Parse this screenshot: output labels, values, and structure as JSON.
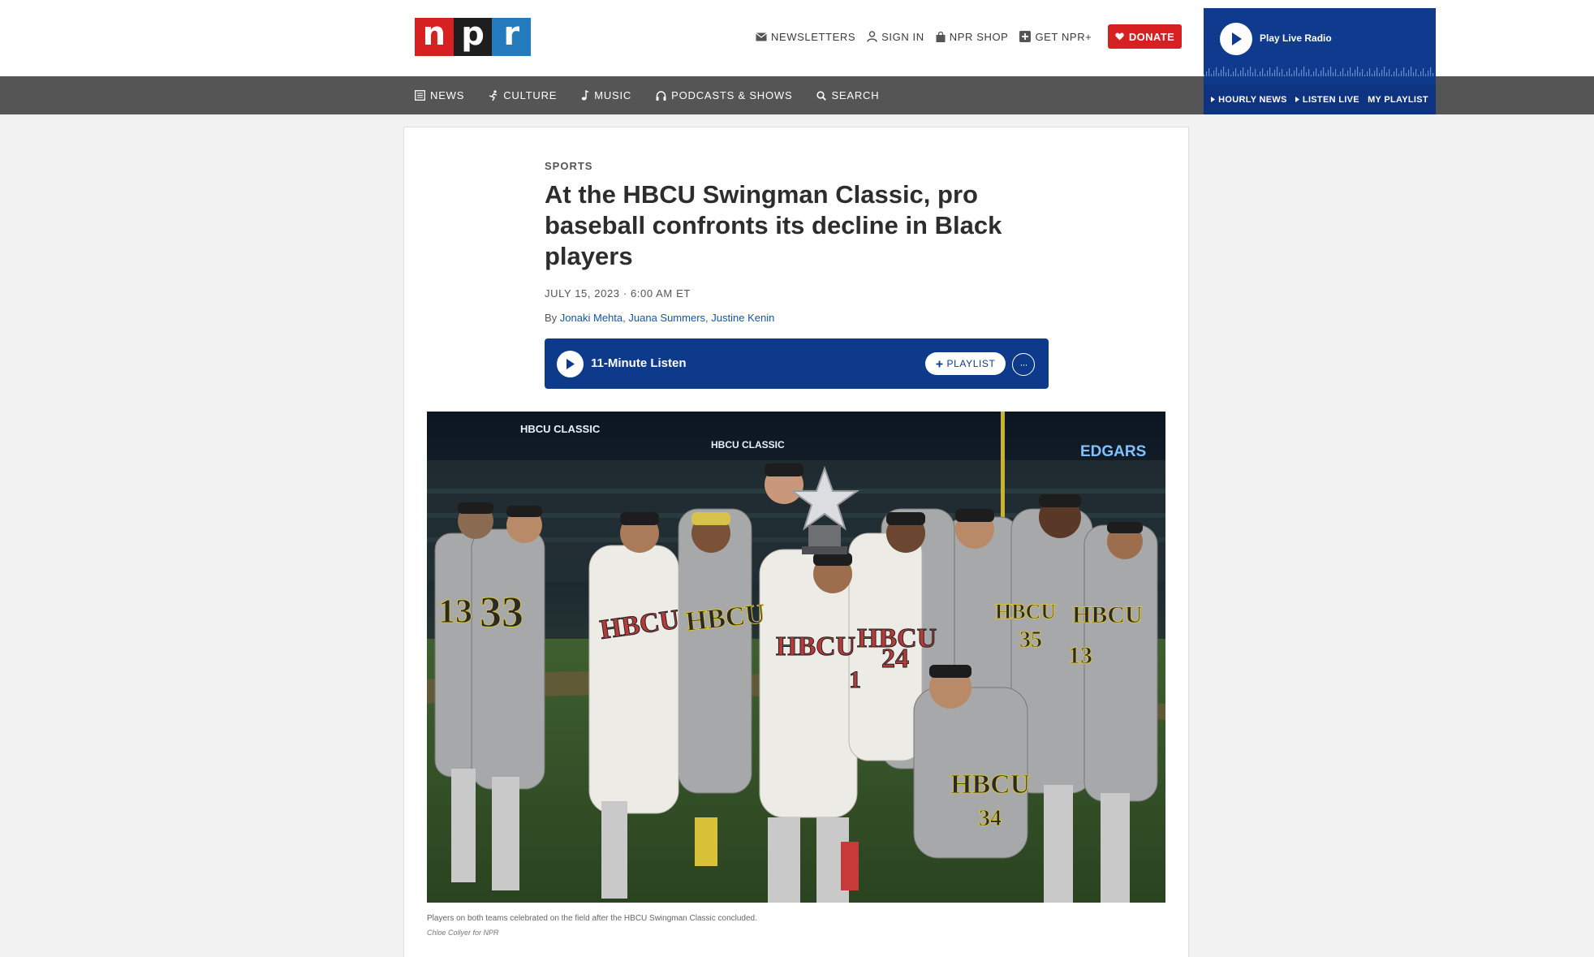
{
  "logo": {
    "letters": [
      "n",
      "p",
      "r"
    ],
    "colors": [
      "#d62021",
      "#1e1e1e",
      "#237bbd"
    ]
  },
  "utility": [
    {
      "icon": "envelope-icon",
      "label": "NEWSLETTERS"
    },
    {
      "icon": "user-icon",
      "label": "SIGN IN"
    },
    {
      "icon": "shopping-bag-icon",
      "label": "NPR SHOP"
    },
    {
      "icon": "plus-square-icon",
      "label": "GET NPR+"
    }
  ],
  "donate": {
    "label": "DONATE",
    "icon": "heart-icon",
    "color": "#d62021"
  },
  "live_radio": {
    "label": "Play Live Radio",
    "links": [
      "HOURLY NEWS",
      "LISTEN LIVE",
      "MY PLAYLIST"
    ],
    "color": "#0e3a8c"
  },
  "nav": [
    {
      "icon": "newspaper-icon",
      "label": "NEWS"
    },
    {
      "icon": "culture-icon",
      "label": "CULTURE"
    },
    {
      "icon": "music-note-icon",
      "label": "MUSIC"
    },
    {
      "icon": "headphones-icon",
      "label": "PODCASTS & SHOWS"
    },
    {
      "icon": "search-icon",
      "label": "SEARCH"
    }
  ],
  "article": {
    "slug": "SPORTS",
    "headline": "At the HBCU Swingman Classic, pro baseball confronts its decline in Black players",
    "dateline": "JULY 15, 2023 · 6:00 AM ET",
    "by": "By",
    "authors": [
      "Jonaki Mehta",
      "Juana Summers",
      "Justine Kenin"
    ],
    "author_separator": ",",
    "audio": {
      "title": "11-Minute Listen",
      "playlist_label": "PLAYLIST",
      "more_label": "···"
    },
    "photo": {
      "jumbotron_left": "HBCU CLASSIC",
      "jumbotron_center": "HBCU CLASSIC",
      "sign_right": "EDGARS",
      "jerseys": [
        "13",
        "33",
        "HBCU",
        "HBCU",
        "HBCU",
        "1",
        "HBCU",
        "24",
        "HBCU",
        "34",
        "35",
        "13",
        "HBCU",
        "HBCU"
      ]
    },
    "caption": "Players on both teams celebrated on the field after the HBCU Swingman Classic concluded.",
    "credit": "Chloe Collyer for NPR"
  }
}
